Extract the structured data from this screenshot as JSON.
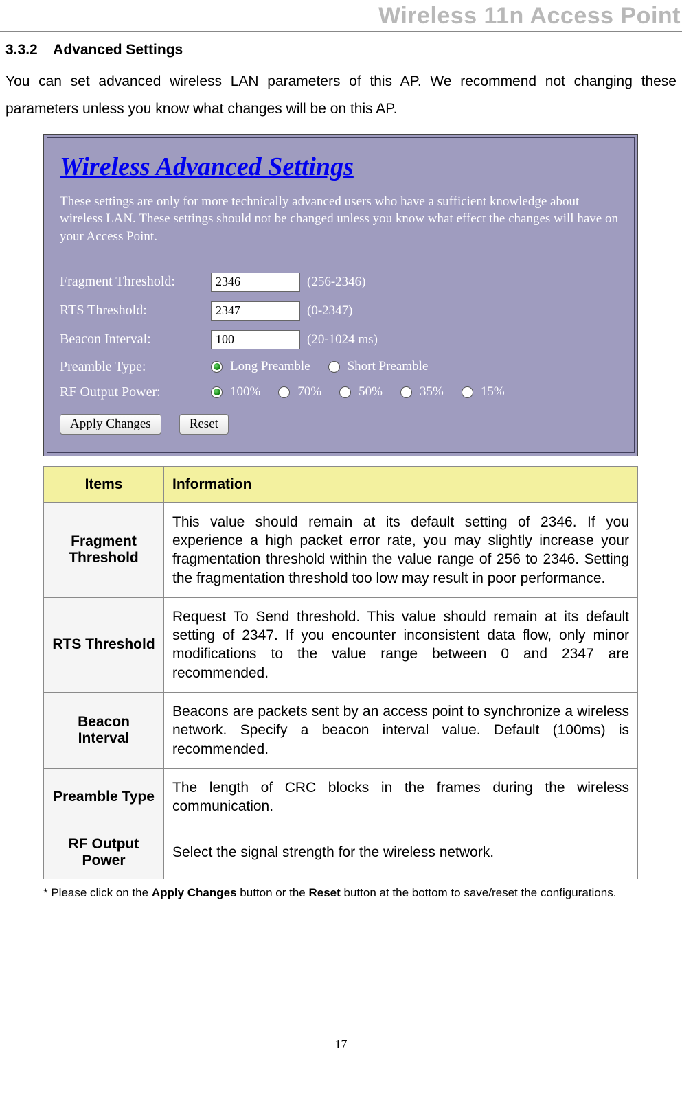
{
  "header": {
    "title": "Wireless 11n Access Point"
  },
  "section": {
    "num": "3.3.2",
    "title": "Advanced Settings",
    "intro": "You can set advanced wireless LAN parameters of this AP. We recommend not changing these parameters unless you know what changes will be on this AP."
  },
  "panel": {
    "title": "Wireless Advanced Settings",
    "note": "These settings are only for more technically advanced users who have a sufficient knowledge about wireless LAN. These settings should not be changed unless you know what effect the changes will have on your Access Point.",
    "rows": {
      "fragment": {
        "label": "Fragment Threshold:",
        "value": "2346",
        "range": "(256-2346)"
      },
      "rts": {
        "label": "RTS Threshold:",
        "value": "2347",
        "range": "(0-2347)"
      },
      "beacon": {
        "label": "Beacon Interval:",
        "value": "100",
        "range": "(20-1024 ms)"
      },
      "preamble": {
        "label": "Preamble Type:",
        "opt1": "Long Preamble",
        "opt2": "Short Preamble"
      },
      "rf": {
        "label": "RF Output Power:",
        "p100": "100%",
        "p70": "70%",
        "p50": "50%",
        "p35": "35%",
        "p15": "15%"
      }
    },
    "buttons": {
      "apply": "Apply Changes",
      "reset": "Reset"
    }
  },
  "table": {
    "head_items": "Items",
    "head_info": "Information",
    "rows": [
      {
        "item": "Fragment Threshold",
        "info": "This value should remain at its default setting of 2346. If you experience a high packet error rate, you may slightly increase your fragmentation threshold within the value range of 256 to 2346. Setting the fragmentation threshold too low may result in poor performance."
      },
      {
        "item": "RTS Threshold",
        "info": "Request To Send threshold. This value should remain at its default setting of 2347. If you encounter inconsistent data flow, only minor modifications to the value range between 0 and 2347 are recommended."
      },
      {
        "item": "Beacon Interval",
        "info": "Beacons are packets sent by an access point to synchronize a wireless network. Specify a beacon interval value. Default (100ms) is recommended."
      },
      {
        "item": "Preamble Type",
        "info": "The length of CRC blocks in the frames during the wireless communication."
      },
      {
        "item": "RF Output Power",
        "info": "Select the signal strength for the wireless network."
      }
    ]
  },
  "footnote": {
    "pre": "* Please click on the ",
    "b1": "Apply Changes",
    "mid": " button or the ",
    "b2": "Reset",
    "post": " button at the bottom to save/reset the configurations."
  },
  "page_number": "17"
}
